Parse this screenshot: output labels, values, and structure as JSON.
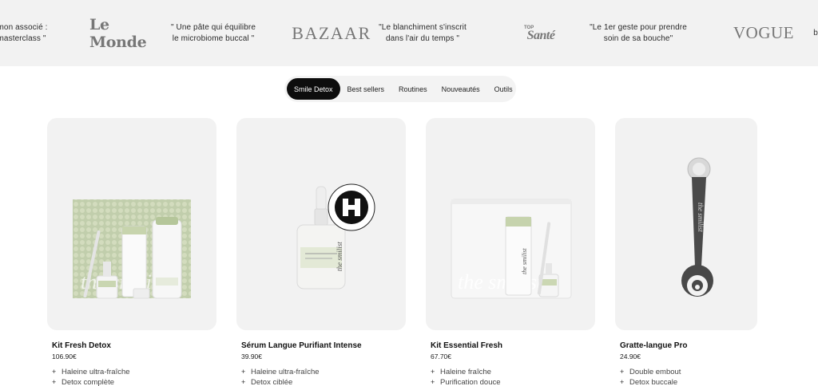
{
  "press": {
    "quotes": [
      {
        "line1": "mon associé :",
        "line2": "masterclass \""
      },
      {
        "line1": "\" Une pâte qui équilibre",
        "line2": "le microbiome buccal \""
      },
      {
        "line1": "\"Le blanchiment s'inscrit",
        "line2": "dans l'air du temps \""
      },
      {
        "line1": "\"Le 1er geste pour prendre",
        "line2": "soin de sa bouche\""
      }
    ],
    "logos": {
      "lemonde": "Le Monde",
      "bazaar": "BAZAAR",
      "sante_top": "TOP",
      "sante_main": "Santé",
      "vogue": "VOGUE"
    }
  },
  "tabs": [
    {
      "label": "Smile Detox",
      "active": true
    },
    {
      "label": "Best sellers",
      "active": false
    },
    {
      "label": "Routines",
      "active": false
    },
    {
      "label": "Nouveautés",
      "active": false
    },
    {
      "label": "Outils",
      "active": false
    }
  ],
  "products": [
    {
      "name": "Kit Fresh Detox",
      "price": "106.90€",
      "features": [
        "Haleine ultra-fraîche",
        "Detox complète"
      ]
    },
    {
      "name": "Sérum Langue Purifiant Intense",
      "price": "39.90€",
      "features": [
        "Haleine ultra-fraîche",
        "Detox ciblée"
      ]
    },
    {
      "name": "Kit Essential Fresh",
      "price": "67.70€",
      "features": [
        "Haleine fraîche",
        "Purification douce"
      ]
    },
    {
      "name": "Gratte-langue Pro",
      "price": "24.90€",
      "features": [
        "Double embout",
        "Detox buccale"
      ]
    }
  ],
  "brand_on_pack": "the smilist",
  "colors": {
    "tab_active_bg": "#0d0d0d",
    "card_bg": "#f2f2f2",
    "press_bg": "#f2f2f2",
    "sage_green": "#b9c9a0"
  }
}
